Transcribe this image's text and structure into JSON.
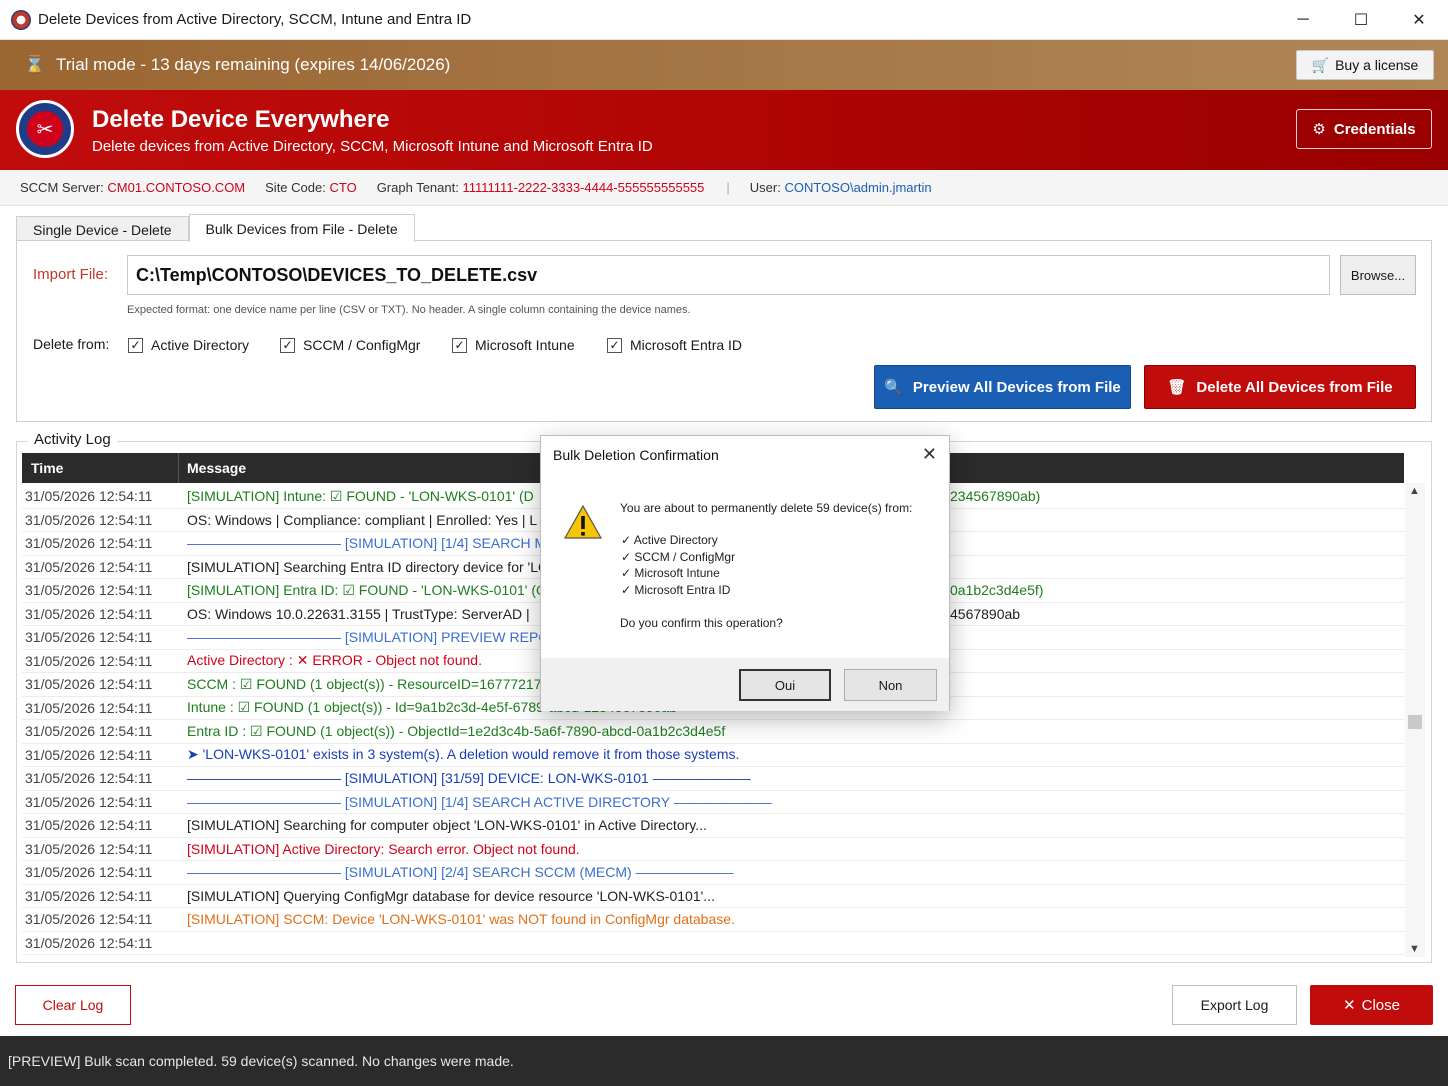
{
  "window": {
    "title": "Delete Devices from Active Directory, SCCM, Intune and Entra ID",
    "minimize": "─",
    "maximize": "☐",
    "close": "✕"
  },
  "trial": {
    "text": "Trial mode - 13 days remaining (expires 14/06/2026)",
    "buy_label": "Buy a license"
  },
  "header": {
    "title": "Delete Device Everywhere",
    "subtitle": "Delete devices from Active Directory, SCCM, Microsoft Intune and Microsoft Entra ID",
    "credentials_label": "Credentials"
  },
  "info": {
    "sccm_label": "SCCM Server:",
    "sccm_value": "CM01.CONTOSO.COM",
    "site_label": "Site Code:",
    "site_value": "CTO",
    "graph_label": "Graph Tenant:",
    "graph_value": "11111111-2222-3333-4444-555555555555",
    "separator": "|",
    "user_label": "User:",
    "user_value": "CONTOSO\\admin.jmartin"
  },
  "tabs": [
    {
      "label": "Single Device - Delete"
    },
    {
      "label": "Bulk Devices from File - Delete"
    }
  ],
  "import": {
    "label": "Import File:",
    "value": "C:\\Temp\\CONTOSO\\DEVICES_TO_DELETE.csv",
    "browse_label": "Browse...",
    "hint": "Expected format: one device name per line (CSV or TXT). No header. A single column containing the device names."
  },
  "delete_from": {
    "label": "Delete from:",
    "options": [
      {
        "label": "Active Directory",
        "checked": "✓"
      },
      {
        "label": "SCCM / ConfigMgr",
        "checked": "✓"
      },
      {
        "label": "Microsoft Intune",
        "checked": "✓"
      },
      {
        "label": "Microsoft Entra ID",
        "checked": "✓"
      }
    ]
  },
  "actions": {
    "preview_label": "Preview All Devices from File",
    "delete_all_label": "Delete All Devices from File"
  },
  "log": {
    "legend": "Activity Log",
    "col_time": "Time",
    "col_message": "Message",
    "rows": [
      {
        "time": "31/05/2026 12:54:11",
        "parts": [
          {
            "text": "[SIMULATION] Intune:  ",
            "cls": "green"
          },
          {
            "text": "☑ ",
            "cls": "green"
          },
          {
            "text": "FOUND - 'LON-WKS-0101' (D",
            "cls": "green"
          },
          {
            "text": "",
            "cls": "green"
          }
        ],
        "right": "234567890ab)",
        "right_cls": "green"
      },
      {
        "time": "31/05/2026 12:54:11",
        "parts": [
          {
            "text": " OS: Windows | Compliance: compliant | Enrolled: Yes | L",
            "cls": "dark"
          }
        ],
        "right": "",
        "right_cls": "dark"
      },
      {
        "time": "31/05/2026 12:54:11",
        "parts": [
          {
            "text": "——————————— [SIMULATION] [1/4] SEARCH MICROSOFT IN",
            "cls": "lightblue"
          }
        ],
        "right": "",
        "right_cls": "lightblue"
      },
      {
        "time": "31/05/2026 12:54:11",
        "parts": [
          {
            "text": "[SIMULATION] Searching Entra ID directory device for 'LO",
            "cls": "dark"
          }
        ],
        "right": "",
        "right_cls": "dark"
      },
      {
        "time": "31/05/2026 12:54:11",
        "parts": [
          {
            "text": "[SIMULATION] Entra ID: ☑ FOUND - 'LON-WKS-0101' (O",
            "cls": "green"
          }
        ],
        "right": "0a1b2c3d4e5f)",
        "right_cls": "green"
      },
      {
        "time": "31/05/2026 12:54:11",
        "parts": [
          {
            "text": " OS: Windows 10.0.22631.3155 | TrustType: ServerAD | ",
            "cls": "dark"
          }
        ],
        "right": "4567890ab",
        "right_cls": "dark"
      },
      {
        "time": "31/05/2026 12:54:11",
        "parts": [
          {
            "text": "——————————— [SIMULATION] PREVIEW REPORT ———————",
            "cls": "lightblue"
          }
        ],
        "right": "",
        "right_cls": "lightblue"
      },
      {
        "time": "31/05/2026 12:54:11",
        "parts": [
          {
            "text": "Active Directory : ",
            "cls": "red"
          },
          {
            "text": "✕",
            "cls": "red"
          },
          {
            "text": " ERROR - Object not found.",
            "cls": "red"
          }
        ],
        "right": "",
        "right_cls": "red"
      },
      {
        "time": "31/05/2026 12:54:11",
        "parts": [
          {
            "text": "SCCM : ☑ FOUND (1 object(s)) - ResourceID=16777217,",
            "cls": "green"
          }
        ],
        "right": "",
        "right_cls": "green"
      },
      {
        "time": "31/05/2026 12:54:11",
        "parts": [
          {
            "text": "Intune : ☑ FOUND (1 object(s)) - Id=9a1b2c3d-4e5f-6789-abcd-1234567890ab",
            "cls": "green"
          }
        ],
        "right": "",
        "right_cls": "green"
      },
      {
        "time": "31/05/2026 12:54:11",
        "parts": [
          {
            "text": "Entra ID : ☑ FOUND (1 object(s)) - ObjectId=1e2d3c4b-5a6f-7890-abcd-0a1b2c3d4e5f",
            "cls": "green"
          }
        ],
        "right": "",
        "right_cls": "green"
      },
      {
        "time": "31/05/2026 12:54:11",
        "parts": [
          {
            "text": "➤ 'LON-WKS-0101' exists in 3 system(s). A deletion would remove it from those systems.",
            "cls": "navy"
          }
        ],
        "right": "",
        "right_cls": "navy"
      },
      {
        "time": "31/05/2026 12:54:11",
        "parts": [
          {
            "text": "——————————— [SIMULATION] [31/59] DEVICE: LON-WKS-0101 ———————",
            "cls": "navy"
          }
        ],
        "right": "",
        "right_cls": "navy"
      },
      {
        "time": "31/05/2026 12:54:11",
        "parts": [
          {
            "text": "——————————— [SIMULATION] [1/4] SEARCH ACTIVE DIRECTORY ———————",
            "cls": "lightblue"
          }
        ],
        "right": "",
        "right_cls": "lightblue"
      },
      {
        "time": "31/05/2026 12:54:11",
        "parts": [
          {
            "text": "[SIMULATION] Searching for computer object 'LON-WKS-0101' in Active Directory...",
            "cls": "dark"
          }
        ],
        "right": "",
        "right_cls": "dark"
      },
      {
        "time": "31/05/2026 12:54:11",
        "parts": [
          {
            "text": "[SIMULATION] Active Directory: Search error. Object not found.",
            "cls": "red"
          }
        ],
        "right": "",
        "right_cls": "red"
      },
      {
        "time": "31/05/2026 12:54:11",
        "parts": [
          {
            "text": "——————————— [SIMULATION] [2/4] SEARCH SCCM (MECM) ———————",
            "cls": "lightblue"
          }
        ],
        "right": "",
        "right_cls": "lightblue"
      },
      {
        "time": "31/05/2026 12:54:11",
        "parts": [
          {
            "text": "[SIMULATION] Querying ConfigMgr database for device resource 'LON-WKS-0101'...",
            "cls": "dark"
          }
        ],
        "right": "",
        "right_cls": "dark"
      },
      {
        "time": "31/05/2026 12:54:11",
        "parts": [
          {
            "text": "[SIMULATION] SCCM: Device 'LON-WKS-0101' was NOT found in ConfigMgr database.",
            "cls": "orange"
          }
        ],
        "right": "",
        "right_cls": "orange"
      },
      {
        "time": "31/05/2026 12:54:11",
        "parts": [
          {
            "text": "",
            "cls": "dark"
          }
        ],
        "right": "",
        "right_cls": "dark"
      }
    ]
  },
  "bottom": {
    "clear_label": "Clear Log",
    "export_label": "Export Log",
    "close_label": "Close"
  },
  "status": {
    "text": "[PREVIEW] Bulk scan completed. 59 device(s) scanned. No changes were made."
  },
  "dialog": {
    "title": "Bulk Deletion Confirmation",
    "message": "You are about to permanently delete 59 device(s) from:",
    "items": [
      "✓ Active Directory",
      "✓ SCCM / ConfigMgr",
      "✓ Microsoft Intune",
      "✓ Microsoft Entra ID"
    ],
    "question": "Do you confirm this operation?",
    "yes_label": "Oui",
    "no_label": "Non"
  },
  "colors": {
    "brand_red": "#c10c0c",
    "trial_brown": "#a87a4a",
    "primary_blue": "#1a5fb4"
  }
}
